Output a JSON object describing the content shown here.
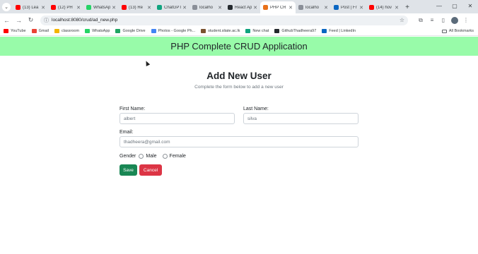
{
  "browser": {
    "tabs": [
      {
        "title": "(13) Lea",
        "color": "#ff0000"
      },
      {
        "title": "(12) PH",
        "color": "#ff0000"
      },
      {
        "title": "WhatsAp",
        "color": "#25d366"
      },
      {
        "title": "(13) Re",
        "color": "#ff0000"
      },
      {
        "title": "ChatGPT",
        "color": "#10a37f"
      },
      {
        "title": "localho",
        "color": "#8a8f98"
      },
      {
        "title": "React Ap",
        "color": "#24292e"
      },
      {
        "title": "PHP CR",
        "color": "#e8711a"
      },
      {
        "title": "localho",
        "color": "#8a8f98"
      },
      {
        "title": "Post | Fr",
        "color": "#0a66c2"
      },
      {
        "title": "(14) hov",
        "color": "#ff0000"
      }
    ],
    "new_tab_icon": "plus-icon",
    "url": "localhost:8080/crud/ad_new.php",
    "bookmarks": [
      {
        "label": "YouTube",
        "color": "#ff0000"
      },
      {
        "label": "Gmail",
        "color": "#ea4335"
      },
      {
        "label": "classroom",
        "color": "#f4b400"
      },
      {
        "label": "WhatsApp",
        "color": "#25d366"
      },
      {
        "label": "Google Drive",
        "color": "#1fa463"
      },
      {
        "label": "Photos - Google Ph...",
        "color": "#4285f4"
      },
      {
        "label": "student.sliate.ac.lk",
        "color": "#7a5230"
      },
      {
        "label": "New chat",
        "color": "#10a37f"
      },
      {
        "label": "GithubThadheera97",
        "color": "#24292e"
      },
      {
        "label": "Feed | LinkedIn",
        "color": "#0a66c2"
      }
    ],
    "all_bookmarks": "All Bookmarks"
  },
  "app": {
    "title": "PHP Complete CRUD Application",
    "header_color": "#98fba9"
  },
  "form": {
    "heading": "Add New User",
    "subheading": "Complete the form below to add a new user",
    "first_name_label": "First Name:",
    "first_name_value": "albert",
    "last_name_label": "Last Name:",
    "last_name_value": "silva",
    "email_label": "Email:",
    "email_value": "thadheera@gmail.com",
    "gender_label": "Gender",
    "gender_options": [
      "Male",
      "Female"
    ],
    "save_label": "Save",
    "cancel_label": "Cancel",
    "save_color": "#198754",
    "cancel_color": "#dc3545"
  }
}
